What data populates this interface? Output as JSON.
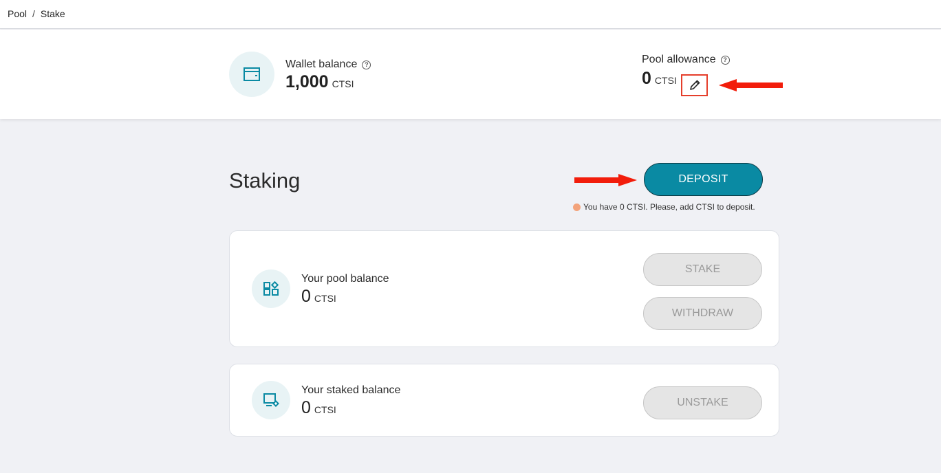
{
  "breadcrumb": {
    "root": "Pool",
    "separator": "/",
    "current": "Stake"
  },
  "wallet": {
    "label": "Wallet balance",
    "help": "?",
    "amount": "1,000",
    "unit": "CTSI",
    "icon": "wallet-icon"
  },
  "allowance": {
    "label": "Pool allowance",
    "help": "?",
    "amount": "0",
    "unit": "CTSI",
    "edit_icon": "pencil-icon"
  },
  "staking": {
    "title": "Staking",
    "deposit_label": "DEPOSIT",
    "notice": "You have 0 CTSI. Please, add CTSI to deposit."
  },
  "pool_card": {
    "label": "Your pool balance",
    "amount": "0",
    "unit": "CTSI",
    "icon": "pool-grid-icon",
    "stake_label": "STAKE",
    "withdraw_label": "WITHDRAW"
  },
  "staked_card": {
    "label": "Your staked balance",
    "amount": "0",
    "unit": "CTSI",
    "icon": "staked-monitor-icon",
    "unstake_label": "UNSTAKE"
  },
  "colors": {
    "accent": "#0a8aa3",
    "annotation": "#e53e2b",
    "warning_dot": "#f3a37b",
    "icon_bg": "#e8f3f5"
  }
}
